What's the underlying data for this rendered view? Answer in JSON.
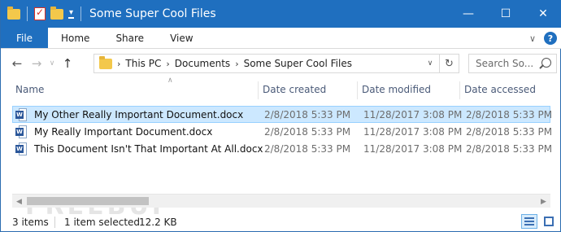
{
  "window": {
    "title": "Some Super Cool Files",
    "controls": {
      "minimize": "—",
      "maximize": "☐",
      "close": "✕"
    }
  },
  "ribbon": {
    "tabs": [
      "File",
      "Home",
      "Share",
      "View"
    ]
  },
  "address": {
    "crumbs": [
      "This PC",
      "Documents",
      "Some Super Cool Files"
    ],
    "search_placeholder": "Search So..."
  },
  "columns": {
    "name": "Name",
    "created": "Date created",
    "modified": "Date modified",
    "accessed": "Date accessed"
  },
  "files": [
    {
      "name": "My Other Really Important Document.docx",
      "created": "2/8/2018 5:33 PM",
      "modified": "11/28/2017 3:08 PM",
      "accessed": "2/8/2018 5:33 PM",
      "selected": true
    },
    {
      "name": "My Really Important Document.docx",
      "created": "2/8/2018 5:33 PM",
      "modified": "11/28/2017 3:08 PM",
      "accessed": "2/8/2018 5:33 PM",
      "selected": false
    },
    {
      "name": "This Document Isn't That Important At All.docx",
      "created": "2/8/2018 5:33 PM",
      "modified": "11/28/2017 3:08 PM",
      "accessed": "2/8/2018 5:33 PM",
      "selected": false
    }
  ],
  "status": {
    "item_count": "3 items",
    "selection": "1 item selected",
    "size": "12.2 KB"
  },
  "watermark": "FREEBUF",
  "colors": {
    "accent": "#1f6fbf",
    "selection_bg": "#cce8ff",
    "selection_border": "#99d1ff",
    "header_text": "#4a5a78"
  }
}
